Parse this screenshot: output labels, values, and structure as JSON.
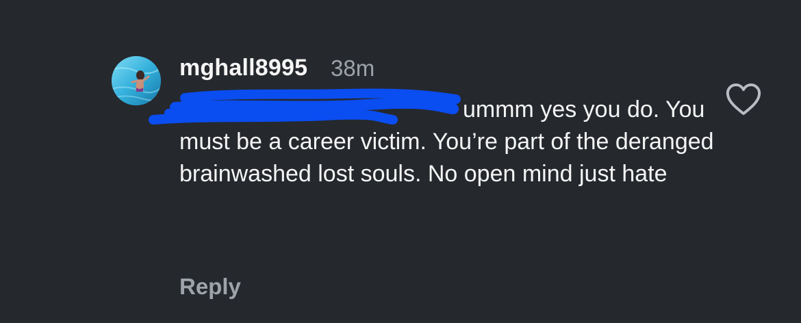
{
  "comment": {
    "username": "mghall8995",
    "timestamp": "38m",
    "mention_redacted": "",
    "text": "ummm yes you do. You must be a career victim. You’re part of the deranged brainwashed lost souls. No open mind just hate",
    "reply_label": "Reply",
    "like_icon": "heart-outline-icon",
    "avatar_icon": "profile-photo-pool"
  },
  "colors": {
    "background": "#25282d",
    "primary_text": "#f5f5f5",
    "secondary_text": "#9ea3aa",
    "redaction_scribble": "#0a4df0"
  }
}
